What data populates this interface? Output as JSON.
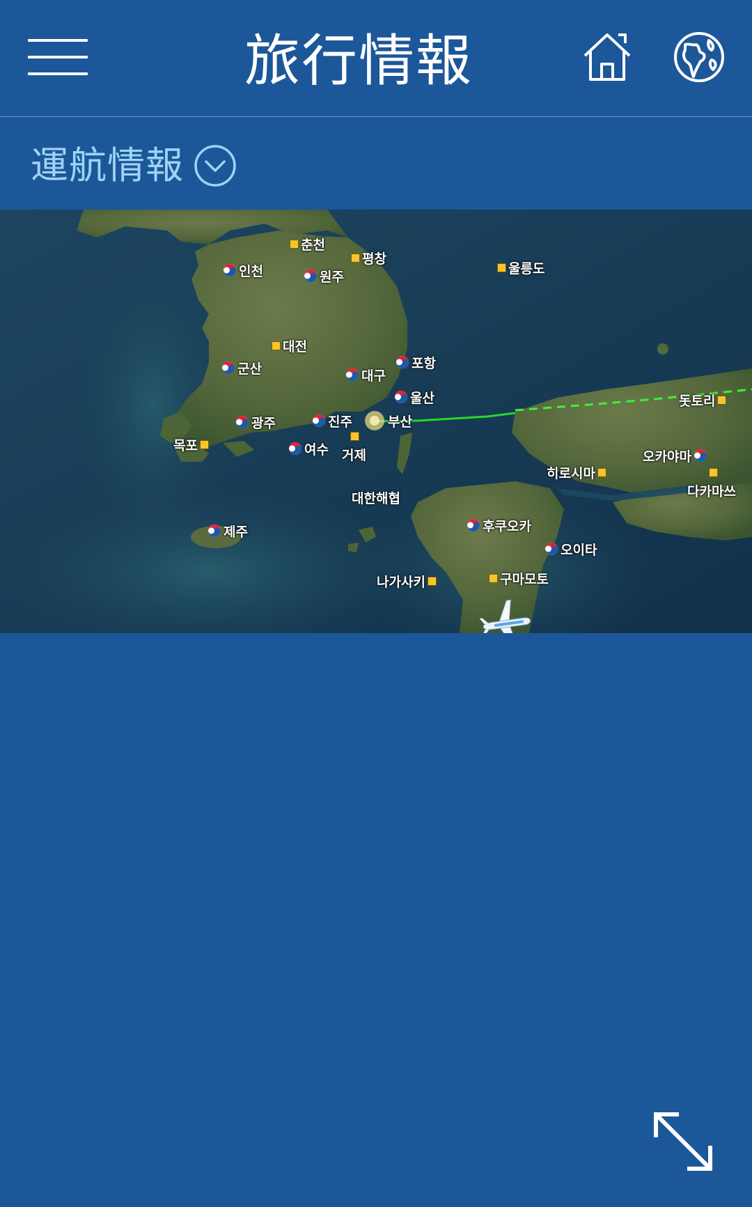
{
  "header": {
    "title": "旅行情報",
    "menu_icon": "hamburger-menu-icon",
    "home_icon": "home-icon",
    "globe_icon": "globe-icon"
  },
  "section": {
    "label": "運航情報",
    "dropdown_icon": "chevron-down-circle-icon"
  },
  "map": {
    "places": [
      {
        "name": "춘천",
        "marker": "square"
      },
      {
        "name": "평창",
        "marker": "square"
      },
      {
        "name": "인천",
        "marker": "airline"
      },
      {
        "name": "원주",
        "marker": "airline"
      },
      {
        "name": "울릉도",
        "marker": "square"
      },
      {
        "name": "대전",
        "marker": "square"
      },
      {
        "name": "군산",
        "marker": "airline"
      },
      {
        "name": "포항",
        "marker": "airline"
      },
      {
        "name": "대구",
        "marker": "airline"
      },
      {
        "name": "울산",
        "marker": "airline"
      },
      {
        "name": "돗토리",
        "marker": "square"
      },
      {
        "name": "광주",
        "marker": "airline"
      },
      {
        "name": "진주",
        "marker": "airline"
      },
      {
        "name": "부산",
        "marker": "origin"
      },
      {
        "name": "목포",
        "marker": "square"
      },
      {
        "name": "여수",
        "marker": "airline"
      },
      {
        "name": "거제",
        "marker": "square"
      },
      {
        "name": "오카야마",
        "marker": "airline"
      },
      {
        "name": "히로시마",
        "marker": "square"
      },
      {
        "name": "다카마쓰",
        "marker": "square"
      },
      {
        "name": "대한해협",
        "marker": "none"
      },
      {
        "name": "후쿠오카",
        "marker": "airline"
      },
      {
        "name": "제주",
        "marker": "airline"
      },
      {
        "name": "오이타",
        "marker": "airline"
      },
      {
        "name": "나가사키",
        "marker": "square"
      },
      {
        "name": "구마모토",
        "marker": "square"
      }
    ],
    "plane_icon": "airplane-icon",
    "route_colors": {
      "flown": "#2bd62b",
      "planned": "#3cf23c"
    }
  },
  "footer": {
    "expand_icon": "expand-fullscreen-icon"
  }
}
